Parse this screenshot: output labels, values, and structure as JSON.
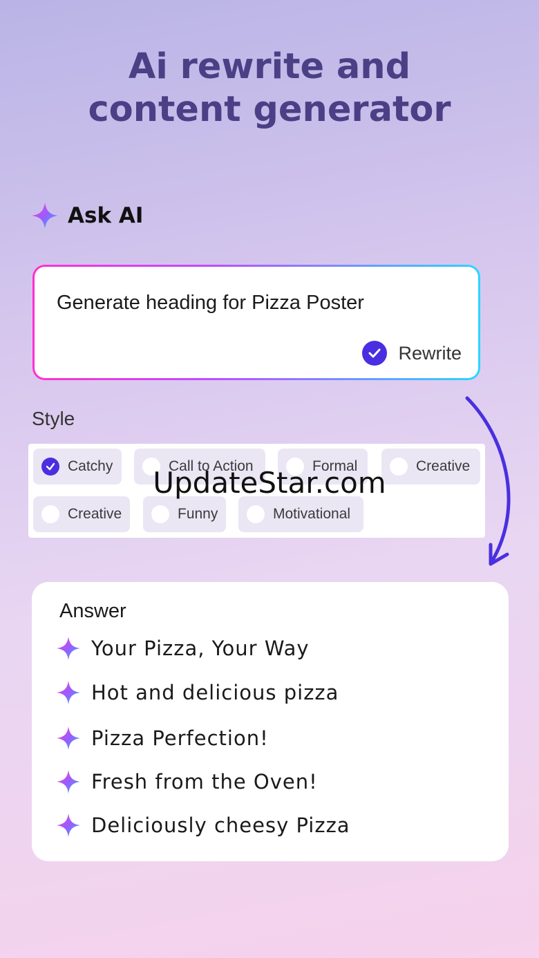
{
  "headline": {
    "line1": "Ai rewrite and",
    "line2": "content generator"
  },
  "ask_ai": {
    "label": "Ask AI",
    "icon": "sparkle-icon"
  },
  "prompt": {
    "text": "Generate heading for Pizza Poster",
    "rewrite_label": "Rewrite",
    "rewrite_checked": true
  },
  "style": {
    "label": "Style",
    "chips": [
      {
        "label": "Catchy",
        "selected": true
      },
      {
        "label": "Call to Action",
        "selected": false
      },
      {
        "label": "Formal",
        "selected": false
      },
      {
        "label": "Creative",
        "selected": false
      },
      {
        "label": "Creative",
        "selected": false
      },
      {
        "label": "Funny",
        "selected": false
      },
      {
        "label": "Motivational",
        "selected": false
      }
    ]
  },
  "watermark": "UpdateStar.com",
  "answer": {
    "title": "Answer",
    "items": [
      "Your Pizza, Your Way",
      "Hot and delicious pizza",
      "Pizza Perfection!",
      "Fresh from the Oven!",
      "Deliciously cheesy Pizza"
    ]
  },
  "colors": {
    "accent": "#4a2fe0",
    "headline": "#4b3f86",
    "sparkle_from": "#ff3fc8",
    "sparkle_to": "#2fb8ff"
  }
}
